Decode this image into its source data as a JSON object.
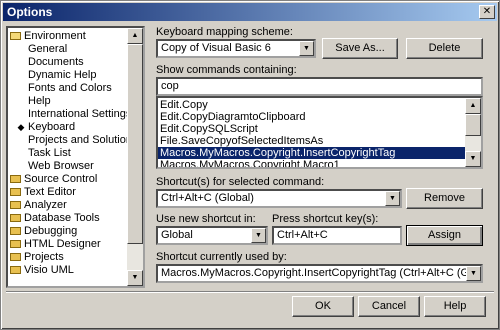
{
  "window": {
    "title": "Options",
    "close_glyph": "✕"
  },
  "tree": {
    "items": [
      {
        "label": "Environment",
        "kind": "folder-open"
      },
      {
        "label": "General",
        "kind": "child"
      },
      {
        "label": "Documents",
        "kind": "child"
      },
      {
        "label": "Dynamic Help",
        "kind": "child"
      },
      {
        "label": "Fonts and Colors",
        "kind": "child"
      },
      {
        "label": "Help",
        "kind": "child"
      },
      {
        "label": "International Settings",
        "kind": "child"
      },
      {
        "label": "Keyboard",
        "kind": "child-current"
      },
      {
        "label": "Projects and Solutions",
        "kind": "child"
      },
      {
        "label": "Task List",
        "kind": "child"
      },
      {
        "label": "Web Browser",
        "kind": "child"
      },
      {
        "label": "Source Control",
        "kind": "folder"
      },
      {
        "label": "Text Editor",
        "kind": "folder"
      },
      {
        "label": "Analyzer",
        "kind": "folder"
      },
      {
        "label": "Database Tools",
        "kind": "folder"
      },
      {
        "label": "Debugging",
        "kind": "folder"
      },
      {
        "label": "HTML Designer",
        "kind": "folder"
      },
      {
        "label": "Projects",
        "kind": "folder"
      },
      {
        "label": "Visio UML",
        "kind": "folder"
      }
    ]
  },
  "keyboard": {
    "mapping_label": "Keyboard mapping scheme:",
    "mapping_value": "Copy of Visual Basic 6",
    "save_as_label": "Save As...",
    "delete_label": "Delete",
    "show_commands_label": "Show commands containing:",
    "search_value": "cop",
    "commands": [
      "Edit.Copy",
      "Edit.CopyDiagramtoClipboard",
      "Edit.CopySQLScript",
      "File.SaveCopyofSelectedItemsAs",
      "Macros.MyMacros.Copyright.InsertCopyrightTag",
      "Macros.MyMacros.Copyright.Macro1"
    ],
    "selected_command_index": 4,
    "shortcuts_label": "Shortcut(s) for selected command:",
    "shortcut_value": "Ctrl+Alt+C (Global)",
    "remove_label": "Remove",
    "use_new_label": "Use new shortcut in:",
    "use_new_value": "Global",
    "press_keys_label": "Press shortcut key(s):",
    "press_keys_value": "Ctrl+Alt+C",
    "assign_label": "Assign",
    "currently_used_label": "Shortcut currently used by:",
    "currently_used_value": "Macros.MyMacros.Copyright.InsertCopyrightTag (Ctrl+Alt+C (Global))"
  },
  "footer": {
    "ok_label": "OK",
    "cancel_label": "Cancel",
    "help_label": "Help"
  }
}
